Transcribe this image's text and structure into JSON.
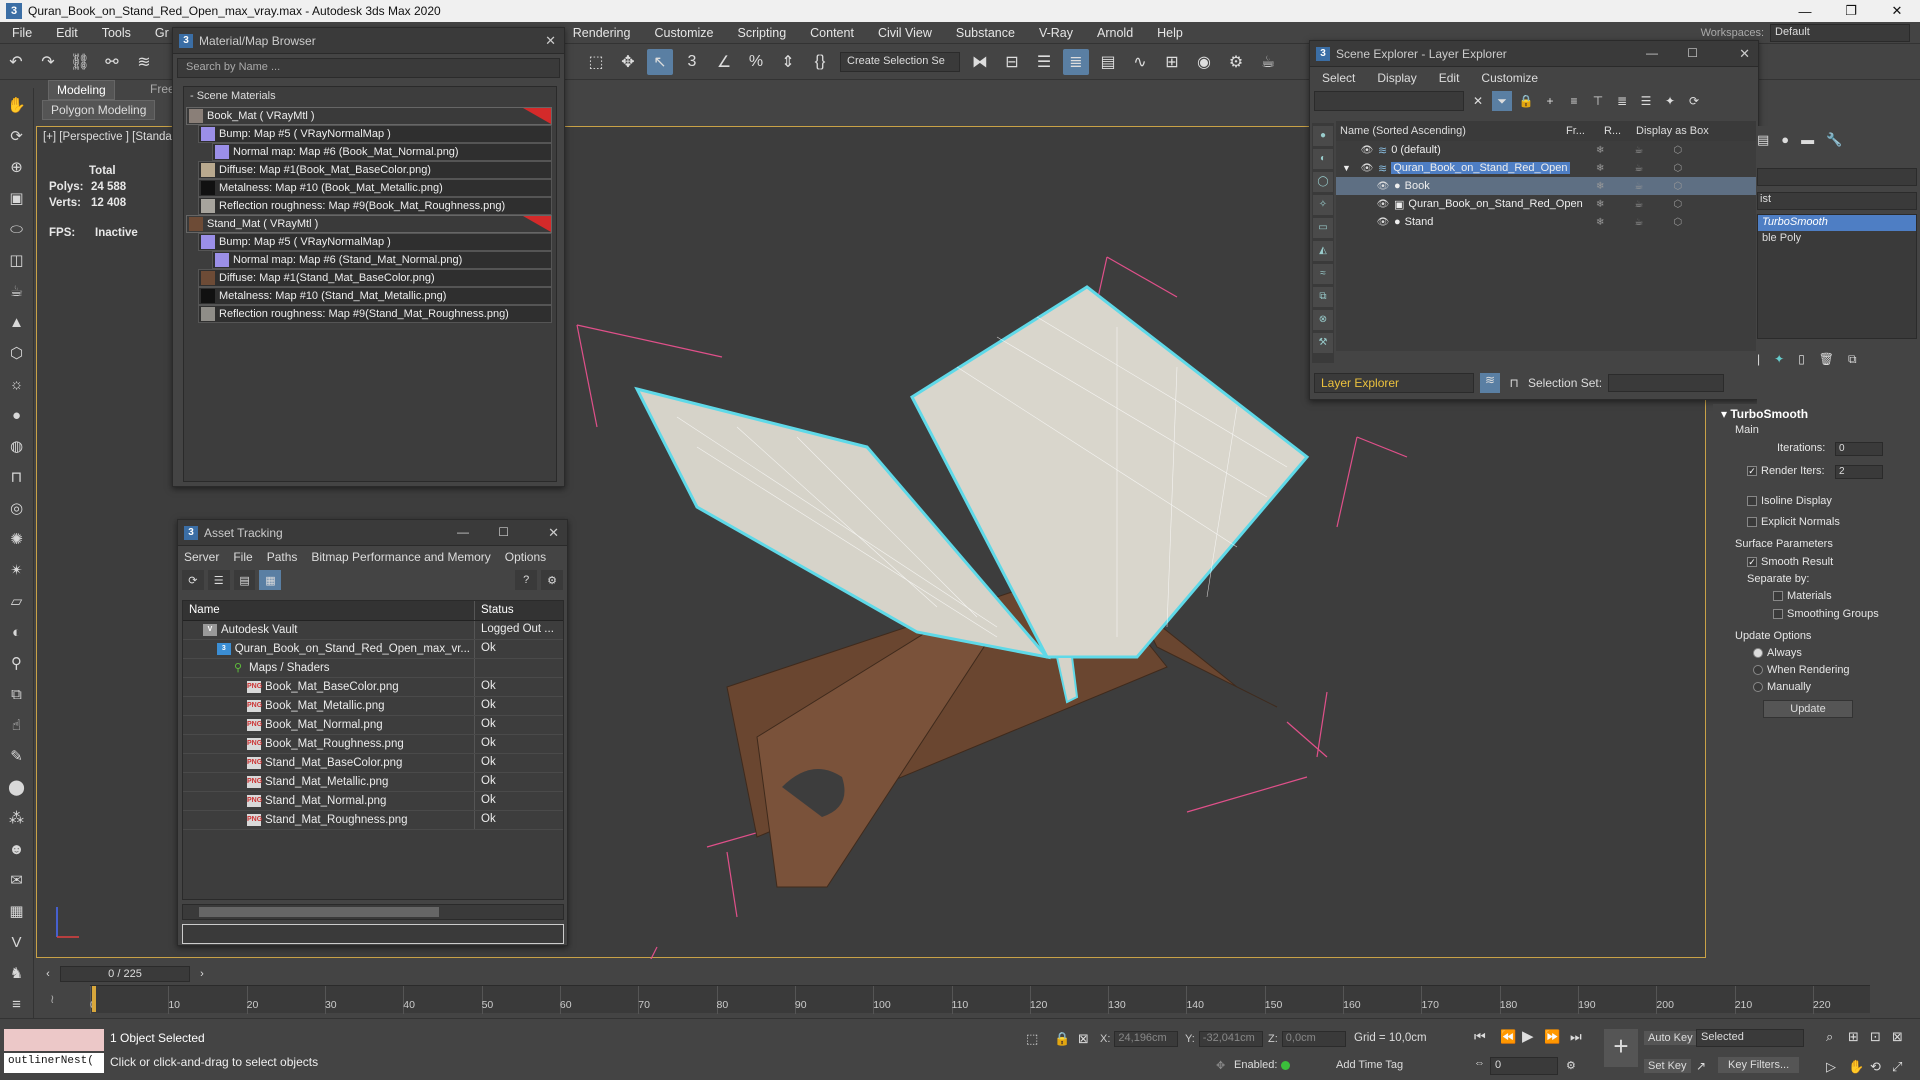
{
  "window": {
    "title": "Quran_Book_on_Stand_Red_Open_max_vray.max - Autodesk 3ds Max 2020",
    "minimize": "—",
    "maximize": "❐",
    "close": "✕"
  },
  "menubar": {
    "items": [
      "File",
      "Edit",
      "Tools",
      "Gr",
      "Rendering",
      "Customize",
      "Scripting",
      "Content",
      "Civil View",
      "Substance",
      "V-Ray",
      "Arnold",
      "Help"
    ],
    "workspaces_label": "Workspaces:",
    "workspace_value": "Default"
  },
  "toolbar": {
    "selection_set": "Create Selection Se"
  },
  "ribbon": {
    "tab_modeling": "Modeling",
    "tab_free": "Free",
    "subtab": "Polygon Modeling"
  },
  "viewport": {
    "label": "[+] [Perspective ] [Standa",
    "stats": {
      "total": "Total",
      "polys_label": "Polys:",
      "polys": "24 588",
      "verts_label": "Verts:",
      "verts": "12 408",
      "fps_label": "FPS:",
      "fps": "Inactive"
    }
  },
  "material_browser": {
    "title": "Material/Map Browser",
    "search_placeholder": "Search by Name ...",
    "section": "- Scene Materials",
    "items": [
      "Book_Mat  ( VRayMtl )",
      "Bump: Map #5  ( VRayNormalMap )",
      "Normal map: Map #6 (Book_Mat_Normal.png)",
      "Diffuse: Map #1(Book_Mat_BaseColor.png)",
      "Metalness: Map #10 (Book_Mat_Metallic.png)",
      "Reflection roughness: Map #9(Book_Mat_Roughness.png)",
      "Stand_Mat  ( VRayMtl )",
      "Bump: Map #5  ( VRayNormalMap )",
      "Normal map: Map #6 (Stand_Mat_Normal.png)",
      "Diffuse: Map #1(Stand_Mat_BaseColor.png)",
      "Metalness: Map #10 (Stand_Mat_Metallic.png)",
      "Reflection roughness: Map #9(Stand_Mat_Roughness.png)"
    ]
  },
  "asset_tracking": {
    "title": "Asset Tracking",
    "menu": [
      "Server",
      "File",
      "Paths",
      "Bitmap Performance and Memory",
      "Options"
    ],
    "col_name": "Name",
    "col_status": "Status",
    "rows": [
      {
        "name": "Autodesk Vault",
        "status": "Logged Out ..."
      },
      {
        "name": "Quran_Book_on_Stand_Red_Open_max_vr...",
        "status": "Ok"
      },
      {
        "name": "Maps / Shaders",
        "status": ""
      },
      {
        "name": "Book_Mat_BaseColor.png",
        "status": "Ok"
      },
      {
        "name": "Book_Mat_Metallic.png",
        "status": "Ok"
      },
      {
        "name": "Book_Mat_Normal.png",
        "status": "Ok"
      },
      {
        "name": "Book_Mat_Roughness.png",
        "status": "Ok"
      },
      {
        "name": "Stand_Mat_BaseColor.png",
        "status": "Ok"
      },
      {
        "name": "Stand_Mat_Metallic.png",
        "status": "Ok"
      },
      {
        "name": "Stand_Mat_Normal.png",
        "status": "Ok"
      },
      {
        "name": "Stand_Mat_Roughness.png",
        "status": "Ok"
      }
    ]
  },
  "scene_explorer": {
    "title": "Scene Explorer - Layer Explorer",
    "menu": [
      "Select",
      "Display",
      "Edit",
      "Customize"
    ],
    "col_name": "Name (Sorted Ascending)",
    "col_fr": "Fr...",
    "col_r": "R...",
    "col_box": "Display as Box",
    "rows": [
      {
        "name": "0 (default)"
      },
      {
        "name": "Quran_Book_on_Stand_Red_Open"
      },
      {
        "name": "Book"
      },
      {
        "name": "Quran_Book_on_Stand_Red_Open"
      },
      {
        "name": "Stand"
      }
    ],
    "layer_explorer": "Layer Explorer",
    "selection_set_label": "Selection Set:"
  },
  "command_panel": {
    "stack_item_1": "TurboSmooth",
    "stack_item_2": "ble Poly",
    "list_label": "ist",
    "turbosmooth": {
      "title": "TurboSmooth",
      "main": "Main",
      "iterations_label": "Iterations:",
      "iterations": "0",
      "render_iters_label": "Render Iters:",
      "render_iters": "2",
      "isoline": "Isoline Display",
      "explicit": "Explicit Normals",
      "surface": "Surface Parameters",
      "smooth_result": "Smooth Result",
      "separate_by": "Separate by:",
      "materials": "Materials",
      "smoothing_groups": "Smoothing Groups",
      "update_options": "Update Options",
      "always": "Always",
      "when_rendering": "When Rendering",
      "manually": "Manually",
      "update_btn": "Update"
    }
  },
  "timeline": {
    "frame": "0 / 225",
    "ticks": [
      "0",
      "10",
      "20",
      "30",
      "40",
      "50",
      "60",
      "70",
      "80",
      "90",
      "100",
      "110",
      "120",
      "130",
      "140",
      "150",
      "160",
      "170",
      "180",
      "190",
      "200",
      "210",
      "220"
    ]
  },
  "statusbar": {
    "maxscript_output": "outlinerNest(",
    "selection": "1 Object Selected",
    "hint": "Click or click-and-drag to select objects",
    "x_label": "X:",
    "x": "24,196cm",
    "y_label": "Y:",
    "y": "-32,041cm",
    "z_label": "Z:",
    "z": "0,0cm",
    "grid": "Grid = 10,0cm",
    "enabled": "Enabled:",
    "add_time_tag": "Add Time Tag",
    "auto_key": "Auto Key",
    "set_key": "Set Key",
    "selected": "Selected",
    "key_filters": "Key Filters...",
    "frame_value": "0"
  }
}
